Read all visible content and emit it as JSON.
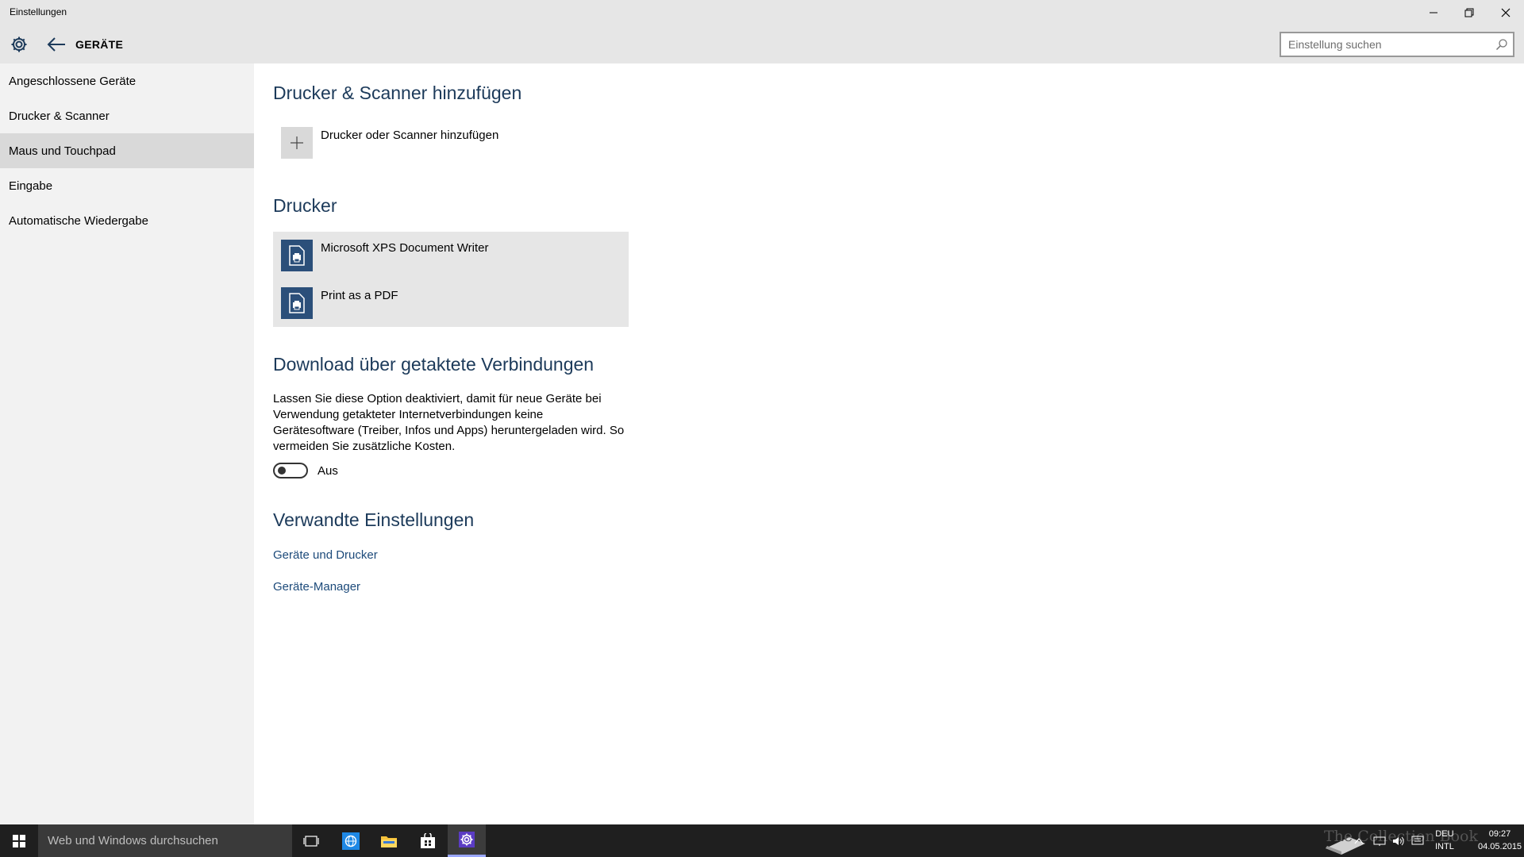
{
  "window": {
    "title": "Einstellungen"
  },
  "header": {
    "section": "GERÄTE",
    "search_placeholder": "Einstellung suchen"
  },
  "sidebar": {
    "items": [
      {
        "label": "Angeschlossene Geräte",
        "active": false
      },
      {
        "label": "Drucker & Scanner",
        "active": false
      },
      {
        "label": "Maus und Touchpad",
        "active": true
      },
      {
        "label": "Eingabe",
        "active": false
      },
      {
        "label": "Automatische Wiedergabe",
        "active": false
      }
    ]
  },
  "main": {
    "add_section": {
      "heading": "Drucker & Scanner hinzufügen",
      "add_label": "Drucker oder Scanner hinzufügen"
    },
    "printers_section": {
      "heading": "Drucker",
      "printers": [
        "Microsoft XPS Document Writer",
        "Print as a PDF"
      ]
    },
    "download_section": {
      "heading": "Download über getaktete Verbindungen",
      "description_lines": [
        "Lassen Sie diese Option deaktiviert, damit für neue Geräte bei",
        "Verwendung getakteter Internetverbindungen keine",
        "Gerätesoftware (Treiber, Infos und Apps) heruntergeladen wird. So",
        "vermeiden Sie zusätzliche Kosten."
      ],
      "toggle_state": "Aus"
    },
    "related_section": {
      "heading": "Verwandte Einstellungen",
      "links": [
        "Geräte und Drucker",
        "Geräte-Manager"
      ]
    }
  },
  "taskbar": {
    "search_placeholder": "Web und Windows durchsuchen",
    "watermark": "The Collection Book",
    "language": {
      "line1": "DEU",
      "line2": "INTL"
    },
    "clock": {
      "time": "09:27",
      "date": "04.05.2015"
    }
  },
  "colors": {
    "accent": "#1c3a5a",
    "link": "#1c4a7a",
    "printer_tile": "#2b4f7a",
    "active_nav": "#d9d9d9"
  }
}
